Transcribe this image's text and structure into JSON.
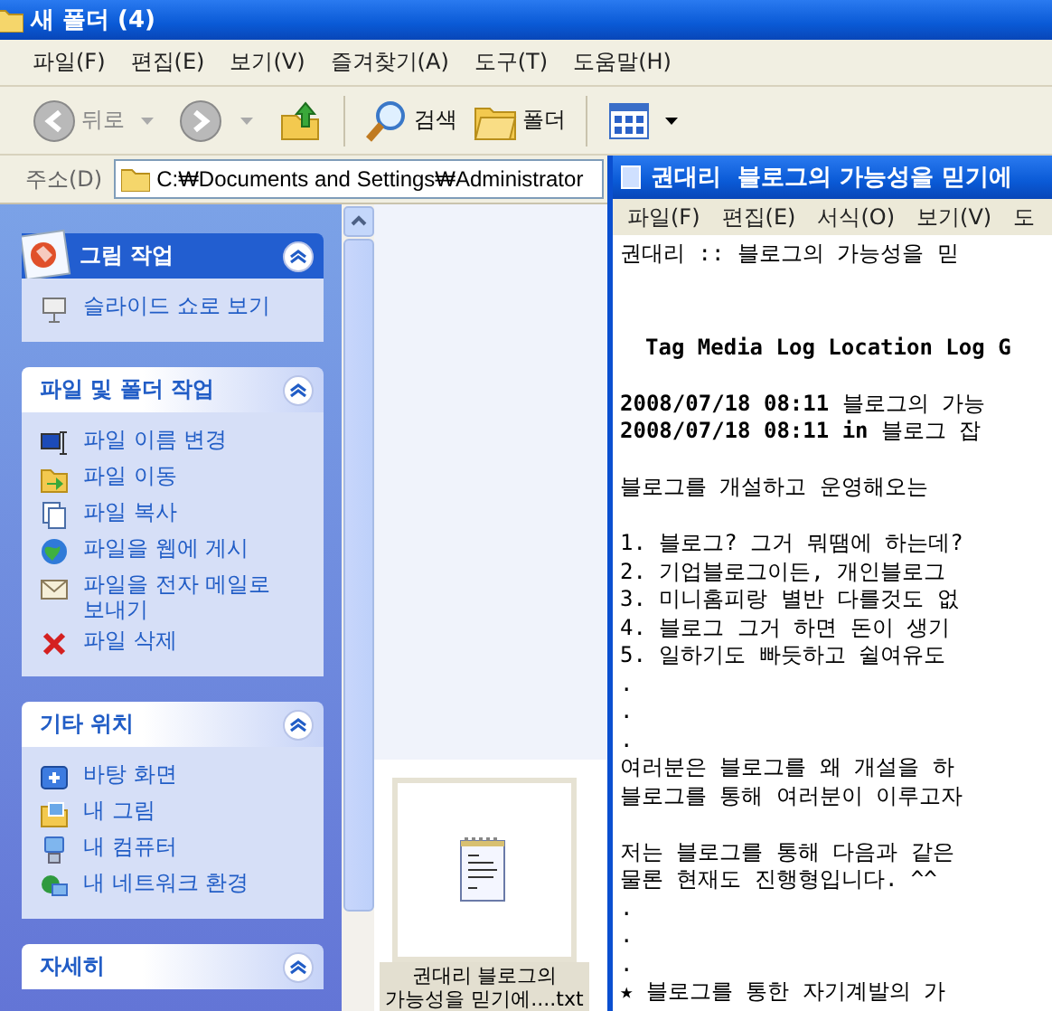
{
  "explorer": {
    "title": "새 폴더 (4)",
    "menu": [
      "파일(F)",
      "편집(E)",
      "보기(V)",
      "즐겨찾기(A)",
      "도구(T)",
      "도움말(H)"
    ],
    "toolbar": {
      "back": "뒤로",
      "search": "검색",
      "folders": "폴더"
    },
    "address": {
      "label": "주소(D)",
      "value": "C:₩Documents and Settings₩Administrator"
    },
    "panels": [
      {
        "title": "그림 작업",
        "kind": "special",
        "expanded": true,
        "items": [
          "슬라이드 쇼로 보기"
        ]
      },
      {
        "title": "파일 및 폴더 작업",
        "kind": "normal",
        "expanded": true,
        "items": [
          "파일 이름 변경",
          "파일 이동",
          "파일 복사",
          "파일을 웹에 게시",
          "파일을 전자 메일로 보내기",
          "파일 삭제"
        ]
      },
      {
        "title": "기타 위치",
        "kind": "normal",
        "expanded": true,
        "items": [
          "바탕 화면",
          "내 그림",
          "내 컴퓨터",
          "내 네트워크 환경"
        ]
      },
      {
        "title": "자세히",
        "kind": "normal",
        "expanded": true
      }
    ],
    "files": [
      {
        "name": "권대리  블로그의 가능성을 믿기에....txt",
        "selected": true
      }
    ]
  },
  "notepad": {
    "title": "권대리  블로그의 가능성을 믿기에",
    "menu": [
      "파일(F)",
      "편집(E)",
      "서식(O)",
      "보기(V)",
      "도"
    ],
    "blocks": [
      {
        "kind": "heading",
        "lines": [
          "권대리 :: 블로그의 가능성을 믿"
        ]
      },
      {
        "kind": "tags",
        "lines": [
          "Tag Media Log Location Log G"
        ]
      },
      {
        "kind": "text",
        "lines": [
          "**2008/07/18 08:11** 블로그의 가능",
          "**2008/07/18 08:11 in** 블로그 잡"
        ]
      },
      {
        "kind": "text",
        "lines": [
          "블로그를 개설하고 운영해오는"
        ]
      },
      {
        "kind": "text",
        "lines": [
          "1. 블로그? 그거 뭐땜에 하는데?",
          "2. 기업블로그이든, 개인블로그",
          "3. 미니홈피랑 별반 다를것도 없",
          "4. 블로그 그거 하면 돈이 생기",
          "5. 일하기도 빠듯하고 쉴여유도",
          ".",
          ".",
          ".",
          "여러분은 블로그를 왜 개설을 하",
          "블로그를 통해 여러분이 이루고자"
        ]
      },
      {
        "kind": "text",
        "lines": [
          "저는 블로그를 통해 다음과 같은",
          "물론 현재도 진행형입니다. ^^",
          ".",
          ".",
          ".",
          "★ 블로그를 통한 자기계발의 가"
        ]
      }
    ]
  }
}
